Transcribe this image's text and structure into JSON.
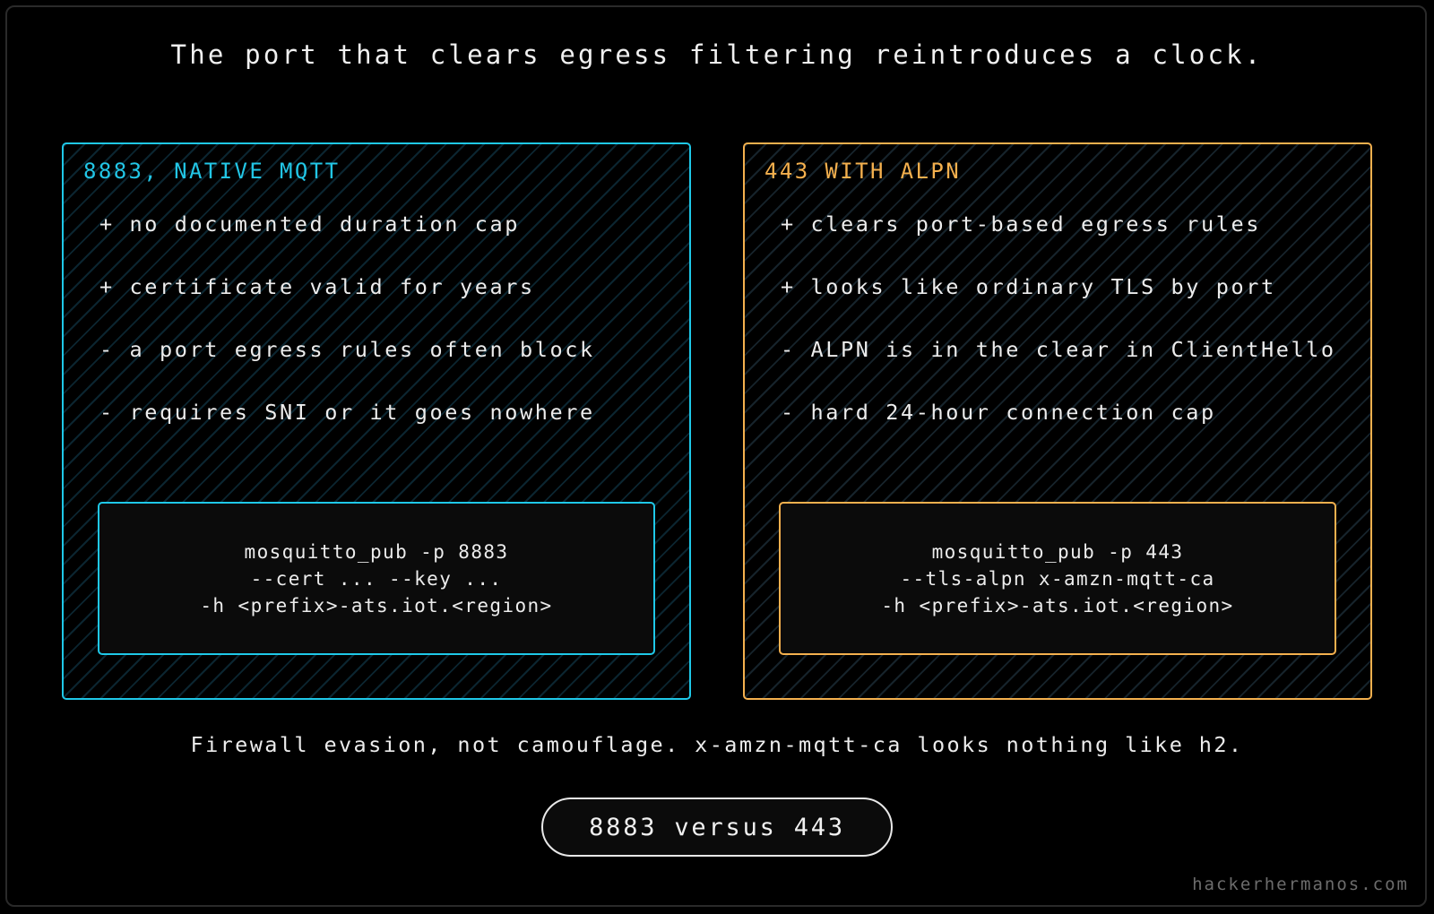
{
  "title": "The port that clears egress filtering reintroduces a clock.",
  "panels": [
    {
      "heading": "8883, NATIVE MQTT",
      "accent": "#1fc8e8",
      "points": [
        "+ no documented duration cap",
        "+ certificate valid for years",
        "- a port egress rules often block",
        "- requires SNI or it goes nowhere"
      ],
      "command": [
        "mosquitto_pub -p 8883",
        "--cert ... --key ...",
        "-h <prefix>-ats.iot.<region>"
      ]
    },
    {
      "heading": "443 WITH ALPN",
      "accent": "#f4b04e",
      "points": [
        "+ clears port-based egress rules",
        "+ looks like ordinary TLS by port",
        "- ALPN is in the clear in ClientHello",
        "- hard 24-hour connection cap"
      ],
      "command": [
        "mosquitto_pub -p 443",
        "--tls-alpn x-amzn-mqtt-ca",
        "-h <prefix>-ats.iot.<region>"
      ]
    }
  ],
  "caption": "Firewall evasion, not camouflage. x-amzn-mqtt-ca looks nothing like h2.",
  "pill": "8883 versus 443",
  "watermark": "hackerhermanos.com"
}
